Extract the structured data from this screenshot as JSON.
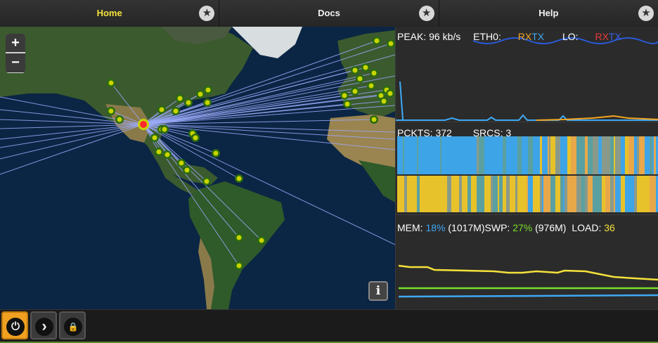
{
  "nav": {
    "tabs": [
      {
        "label": "Home",
        "active": true,
        "icon": "star-icon"
      },
      {
        "label": "Docs",
        "active": false,
        "icon": "star-icon"
      },
      {
        "label": "Help",
        "active": false,
        "icon": "star-icon"
      }
    ],
    "star_glyph": "★"
  },
  "map": {
    "zoom_in_label": "+",
    "zoom_out_label": "−",
    "info_label": "i",
    "colors": {
      "ocean": "#0b2544",
      "land": "#3b5a2e",
      "desert": "#8a7a4a",
      "ice": "#d8dde0",
      "line": "#9aa8f8",
      "node": "#c8d400",
      "origin": "#ff2a2a"
    }
  },
  "network": {
    "peak_label": "PEAK:",
    "peak_value": "96 kb/s",
    "iface1_label": "ETH0:",
    "iface2_label": "LO:",
    "rx_label": "RX",
    "tx_label": "TX",
    "colors": {
      "eth_rx": "#f5a623",
      "eth_tx": "#3fa9f5",
      "lo_rx": "#e83a3a",
      "lo_tx": "#3a5fe8"
    }
  },
  "packets": {
    "pckts_label": "PCKTS:",
    "pckts_value": "372",
    "srcs_label": "SRCS:",
    "srcs_value": "3",
    "colors": {
      "blue": "#3ea4e8",
      "yellow": "#e8c22a",
      "orange": "#e8a84a",
      "gray": "#8a9a8a",
      "teal": "#5aa0a0"
    }
  },
  "system": {
    "mem_label": "MEM:",
    "mem_value": "18%",
    "mem_detail": "(1017M)",
    "swp_label": "SWP:",
    "swp_value": "27%",
    "swp_detail": "(976M)",
    "load_label": "LOAD:",
    "load_value": "36",
    "colors": {
      "mem": "#3fa9f5",
      "swp": "#7ae02a",
      "load": "#f5e23a"
    }
  },
  "bottom": {
    "buttons": [
      {
        "name": "power-button",
        "icon": "power-icon",
        "glyph": "⏻",
        "active": true
      },
      {
        "name": "next-button",
        "icon": "chevron-right-icon",
        "glyph": "›",
        "active": false
      },
      {
        "name": "lock-button",
        "icon": "lock-icon",
        "glyph": "🔒",
        "active": false
      }
    ]
  }
}
